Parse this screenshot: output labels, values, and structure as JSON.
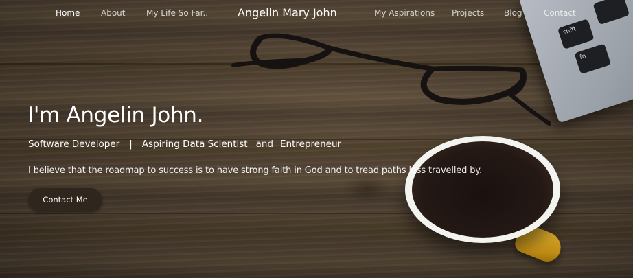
{
  "nav": {
    "left_items": [
      {
        "label": "Home",
        "active": true
      },
      {
        "label": "About",
        "active": false
      },
      {
        "label": "My Life So Far..",
        "active": false
      }
    ],
    "brand": "Angelin Mary John",
    "right_items": [
      {
        "label": "My Aspirations",
        "active": false
      },
      {
        "label": "Projects",
        "active": false
      },
      {
        "label": "Blog",
        "active": false
      },
      {
        "label": "Contact",
        "active": false
      }
    ]
  },
  "hero": {
    "headline": "I'm Angelin John.",
    "roles": [
      "Software Developer",
      "Aspiring Data Scientist",
      "Entrepreneur"
    ],
    "role_separator": "|",
    "role_conjunction": "and",
    "tagline": "I believe that the roadmap to success is to have strong faith in God and to tread paths less travelled by.",
    "cta_label": "Contact Me"
  },
  "background": {
    "keys": [
      "shift",
      "fn"
    ]
  },
  "colors": {
    "text": "#ffffff",
    "button_bg": "#2f261e",
    "cup_handle": "#d4a022"
  }
}
